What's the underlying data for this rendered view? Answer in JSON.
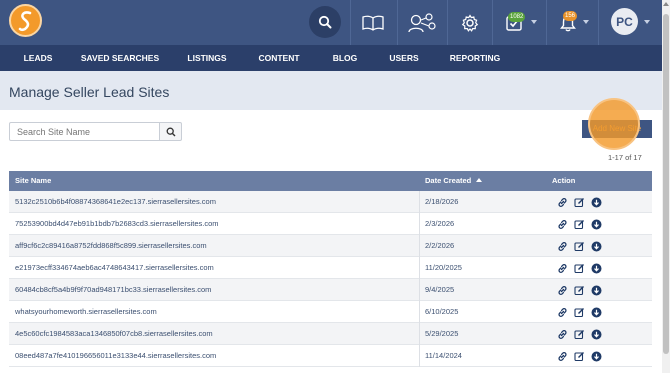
{
  "header": {
    "logo_icon": "sierra-s-logo",
    "icons": [
      "search-icon",
      "book-icon",
      "people-network-icon",
      "gear-icon",
      "tasks-icon",
      "bell-icon"
    ],
    "tasks_badge": "1082",
    "notifications_badge": "156",
    "avatar_initials": "PC",
    "colors": {
      "topbar": "#3e5582",
      "nav": "#2b3f6a",
      "accent": "#f39a2b",
      "badge_green": "#5aa33c",
      "badge_orange": "#e8932b"
    }
  },
  "nav": {
    "items": [
      "LEADS",
      "SAVED SEARCHES",
      "LISTINGS",
      "CONTENT",
      "BLOG",
      "USERS",
      "REPORTING"
    ]
  },
  "page": {
    "title": "Manage Seller Lead Sites",
    "search_placeholder": "Search Site Name",
    "add_button": "Add New Site",
    "count": "1-17 of 17"
  },
  "table": {
    "headers": {
      "site_name": "Site Name",
      "date_created": "Date Created",
      "action": "Action"
    },
    "rows": [
      {
        "site": "5132c2510b6b4f08874368641e2ec137.sierrasellersites.com",
        "date": "2/18/2026"
      },
      {
        "site": "75253900bd4d47eb91b1bdb7b2683cd3.sierrasellersites.com",
        "date": "2/3/2026"
      },
      {
        "site": "aff9cf6c2c89416a8752fdd868f5c899.sierrasellersites.com",
        "date": "2/2/2026"
      },
      {
        "site": "e21973ecff334674aeb6ac4748643417.sierrasellersites.com",
        "date": "11/20/2025"
      },
      {
        "site": "60484cb8cf5a4b9f9f70ad948171bc33.sierrasellersites.com",
        "date": "9/4/2025"
      },
      {
        "site": "whatsyourhomeworth.sierrasellersites.com",
        "date": "6/10/2025"
      },
      {
        "site": "4e5c60cfc1984583aca1346850f07cb8.sierrasellersites.com",
        "date": "5/29/2025"
      },
      {
        "site": "08eed487a7fe410196656011e3133e44.sierrasellersites.com",
        "date": "11/14/2024"
      }
    ],
    "action_icons": [
      "link-icon",
      "edit-icon",
      "download-icon"
    ]
  }
}
